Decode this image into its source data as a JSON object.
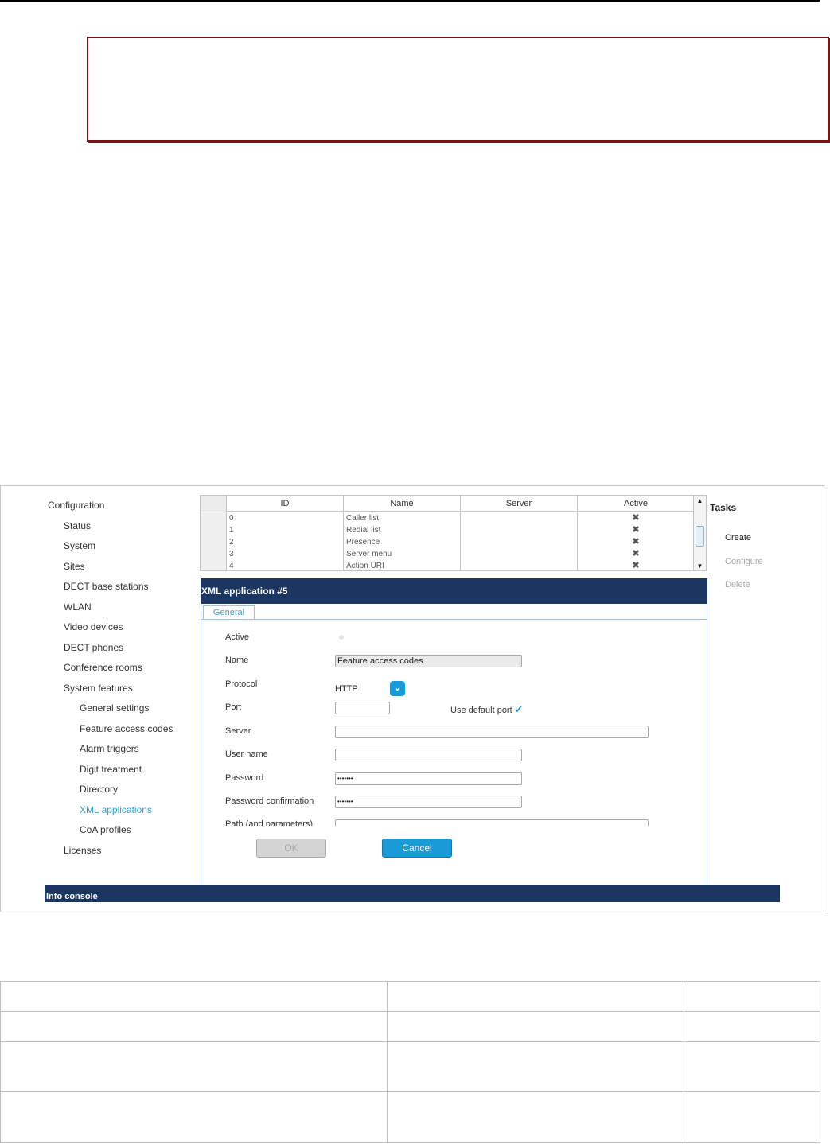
{
  "nav": {
    "items": [
      {
        "label": "Configuration",
        "level": 0,
        "active": false
      },
      {
        "label": "Status",
        "level": 1,
        "active": false
      },
      {
        "label": "System",
        "level": 1,
        "active": false
      },
      {
        "label": "Sites",
        "level": 1,
        "active": false
      },
      {
        "label": "DECT base stations",
        "level": 1,
        "active": false
      },
      {
        "label": "WLAN",
        "level": 1,
        "active": false
      },
      {
        "label": "Video devices",
        "level": 1,
        "active": false
      },
      {
        "label": "DECT phones",
        "level": 1,
        "active": false
      },
      {
        "label": "Conference rooms",
        "level": 1,
        "active": false
      },
      {
        "label": "System features",
        "level": 1,
        "active": false
      },
      {
        "label": "General settings",
        "level": 2,
        "active": false
      },
      {
        "label": "Feature access codes",
        "level": 2,
        "active": false
      },
      {
        "label": "Alarm triggers",
        "level": 2,
        "active": false
      },
      {
        "label": "Digit treatment",
        "level": 2,
        "active": false
      },
      {
        "label": "Directory",
        "level": 2,
        "active": false
      },
      {
        "label": "XML applications",
        "level": 2,
        "active": true
      },
      {
        "label": "CoA profiles",
        "level": 2,
        "active": false
      },
      {
        "label": "Licenses",
        "level": 1,
        "active": false
      }
    ]
  },
  "table": {
    "columns": [
      "ID",
      "Name",
      "Server",
      "Active"
    ],
    "rows": [
      {
        "id": "0",
        "name": "Caller list",
        "server": "",
        "active": "✖"
      },
      {
        "id": "1",
        "name": "Redial list",
        "server": "",
        "active": "✖"
      },
      {
        "id": "2",
        "name": "Presence",
        "server": "",
        "active": "✖"
      },
      {
        "id": "3",
        "name": "Server menu",
        "server": "",
        "active": "✖"
      },
      {
        "id": "4",
        "name": "Action URI",
        "server": "",
        "active": "✖"
      }
    ]
  },
  "tasks": {
    "title": "Tasks",
    "items": [
      {
        "label": "Create",
        "enabled": true
      },
      {
        "label": "Configure",
        "enabled": false
      },
      {
        "label": "Delete",
        "enabled": false
      }
    ]
  },
  "dialog": {
    "title": "XML application #5",
    "tab": "General",
    "fields": {
      "active_label": "Active",
      "name_label": "Name",
      "name_value": "Feature access codes",
      "protocol_label": "Protocol",
      "protocol_value": "HTTP",
      "port_label": "Port",
      "port_value": "",
      "use_default_port_label": "Use default port",
      "use_default_port_checked": true,
      "server_label": "Server",
      "server_value": "",
      "username_label": "User name",
      "username_value": "",
      "password_label": "Password",
      "password_value": "•••••••",
      "password_confirm_label": "Password confirmation",
      "password_confirm_value": "•••••••",
      "path_label": "Path (and parameters)",
      "path_value": ""
    },
    "ok_label": "OK",
    "cancel_label": "Cancel"
  },
  "console": {
    "label": "Info console"
  },
  "colors": {
    "navy": "#1b3661",
    "accent": "#1a9ad6",
    "active_link": "#2ea3d6",
    "note_border": "#7a1218"
  }
}
